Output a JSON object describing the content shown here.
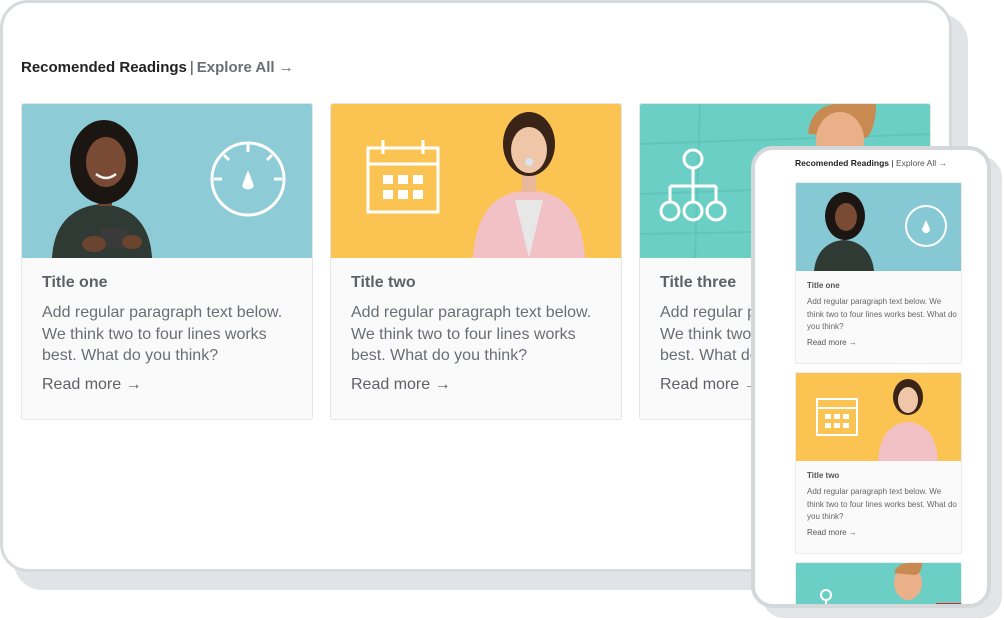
{
  "desktop": {
    "heading": {
      "title": "Recomended Readings",
      "separator": "|",
      "explore": "Explore All →"
    },
    "cards": [
      {
        "title": "Title one",
        "text": "Add regular paragraph text below. We think two to four lines works best. What do you think?",
        "link": "Read more →",
        "icon": "speedometer-icon",
        "bg": "#86c8d3"
      },
      {
        "title": "Title two",
        "text": "Add regular paragraph text below. We think two to four lines works best. What do you think?",
        "link": "Read more →",
        "icon": "calendar-icon",
        "bg": "#fbc352"
      },
      {
        "title": "Title three",
        "text": "Add regular paragraph text below. We think two to four lines works best. What do you think?",
        "link": "Read more →",
        "icon": "hierarchy-icon",
        "bg": "#6ccfc6"
      }
    ]
  },
  "mobile": {
    "heading": {
      "title": "Recomended Readings",
      "separator": "|",
      "explore": "Explore All →"
    },
    "cards": [
      {
        "title": "Title one",
        "text": "Add regular paragraph text below. We think two to four lines works best. What do you think?",
        "link": "Read more →"
      },
      {
        "title": "Title two",
        "text": "Add regular paragraph text below. We think two to four lines works best. What do you think?",
        "link": "Read more →"
      }
    ]
  },
  "colors": {
    "blue_bg": "#86c8d3",
    "yellow_bg": "#fbc352",
    "teal_bg": "#6ccfc6",
    "frame": "#d7dadd"
  }
}
